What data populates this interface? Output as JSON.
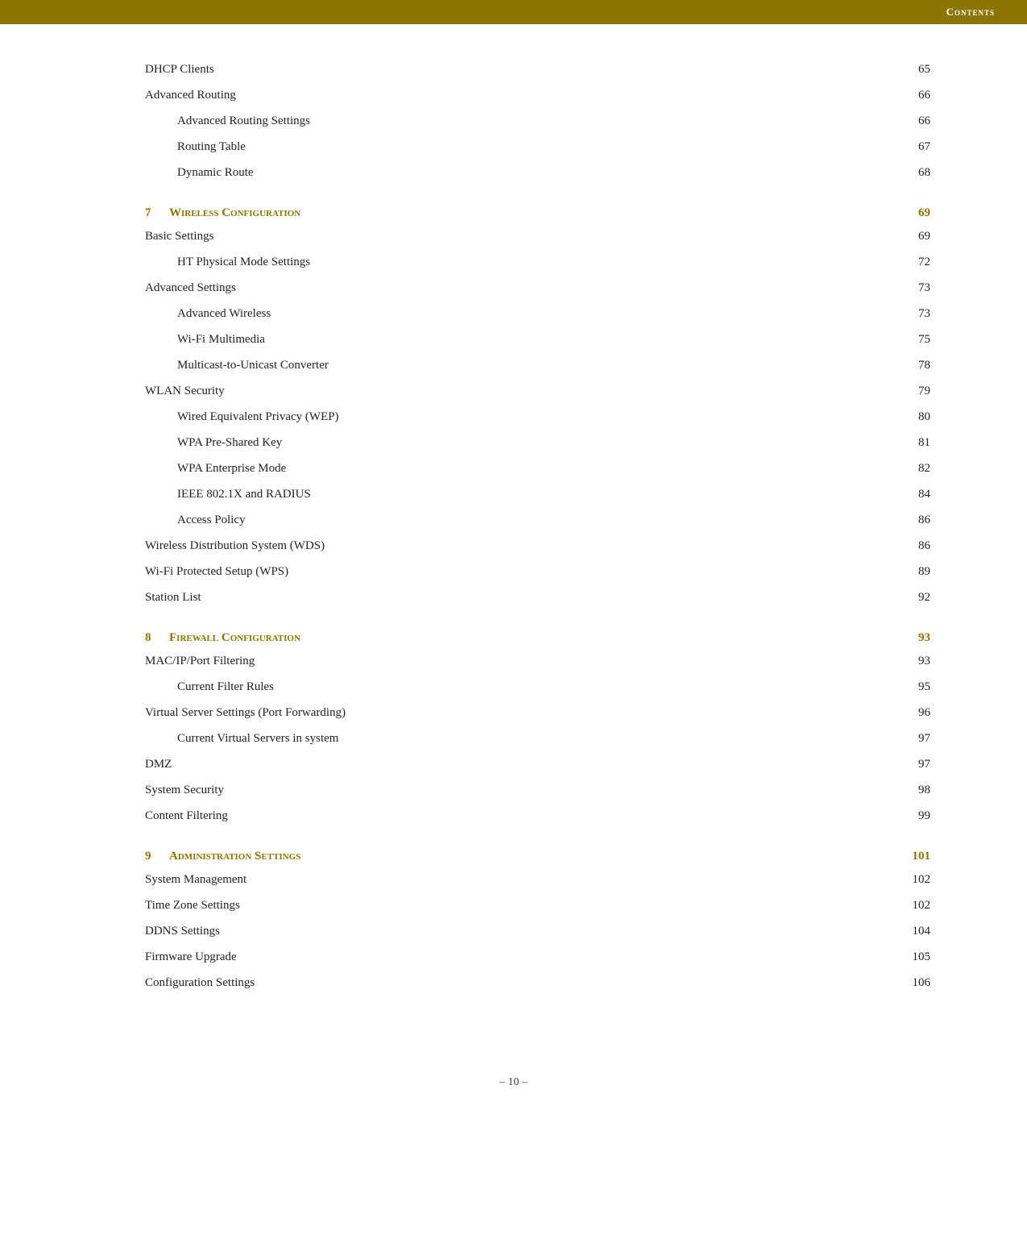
{
  "header": {
    "label": "Contents"
  },
  "sections": [
    {
      "type": "entries",
      "items": [
        {
          "level": 1,
          "text": "DHCP Clients",
          "page": "65"
        },
        {
          "level": 1,
          "text": "Advanced Routing",
          "page": "66"
        },
        {
          "level": 2,
          "text": "Advanced Routing Settings",
          "page": "66"
        },
        {
          "level": 2,
          "text": "Routing Table",
          "page": "67"
        },
        {
          "level": 2,
          "text": "Dynamic Route",
          "page": "68"
        }
      ]
    },
    {
      "type": "chapter",
      "number": "7",
      "title": "Wireless Configuration",
      "page": "69",
      "items": [
        {
          "level": 1,
          "text": "Basic Settings",
          "page": "69"
        },
        {
          "level": 2,
          "text": "HT Physical Mode Settings",
          "page": "72"
        },
        {
          "level": 1,
          "text": "Advanced Settings",
          "page": "73"
        },
        {
          "level": 2,
          "text": "Advanced Wireless",
          "page": "73"
        },
        {
          "level": 2,
          "text": "Wi-Fi Multimedia",
          "page": "75"
        },
        {
          "level": 2,
          "text": "Multicast-to-Unicast Converter",
          "page": "78"
        },
        {
          "level": 1,
          "text": "WLAN Security",
          "page": "79"
        },
        {
          "level": 2,
          "text": "Wired Equivalent Privacy (WEP)",
          "page": "80"
        },
        {
          "level": 2,
          "text": "WPA Pre-Shared Key",
          "page": "81"
        },
        {
          "level": 2,
          "text": "WPA Enterprise Mode",
          "page": "82"
        },
        {
          "level": 2,
          "text": "IEEE 802.1X and RADIUS",
          "page": "84"
        },
        {
          "level": 2,
          "text": "Access Policy",
          "page": "86"
        },
        {
          "level": 1,
          "text": "Wireless Distribution System (WDS)",
          "page": "86"
        },
        {
          "level": 1,
          "text": "Wi-Fi Protected Setup (WPS)",
          "page": "89"
        },
        {
          "level": 1,
          "text": "Station List",
          "page": "92"
        }
      ]
    },
    {
      "type": "chapter",
      "number": "8",
      "title": "Firewall Configuration",
      "page": "93",
      "items": [
        {
          "level": 1,
          "text": "MAC/IP/Port Filtering",
          "page": "93"
        },
        {
          "level": 2,
          "text": "Current Filter Rules",
          "page": "95"
        },
        {
          "level": 1,
          "text": "Virtual Server Settings (Port Forwarding)",
          "page": "96"
        },
        {
          "level": 2,
          "text": "Current Virtual Servers in system",
          "page": "97"
        },
        {
          "level": 1,
          "text": "DMZ",
          "page": "97"
        },
        {
          "level": 1,
          "text": "System Security",
          "page": "98"
        },
        {
          "level": 1,
          "text": "Content Filtering",
          "page": "99"
        }
      ]
    },
    {
      "type": "chapter",
      "number": "9",
      "title": "Administration Settings",
      "page": "101",
      "items": [
        {
          "level": 1,
          "text": "System Management",
          "page": "102"
        },
        {
          "level": 1,
          "text": "Time Zone Settings",
          "page": "102"
        },
        {
          "level": 1,
          "text": "DDNS Settings",
          "page": "104"
        },
        {
          "level": 1,
          "text": "Firmware Upgrade",
          "page": "105"
        },
        {
          "level": 1,
          "text": "Configuration Settings",
          "page": "106"
        }
      ]
    }
  ],
  "footer": {
    "page": "– 10 –"
  }
}
